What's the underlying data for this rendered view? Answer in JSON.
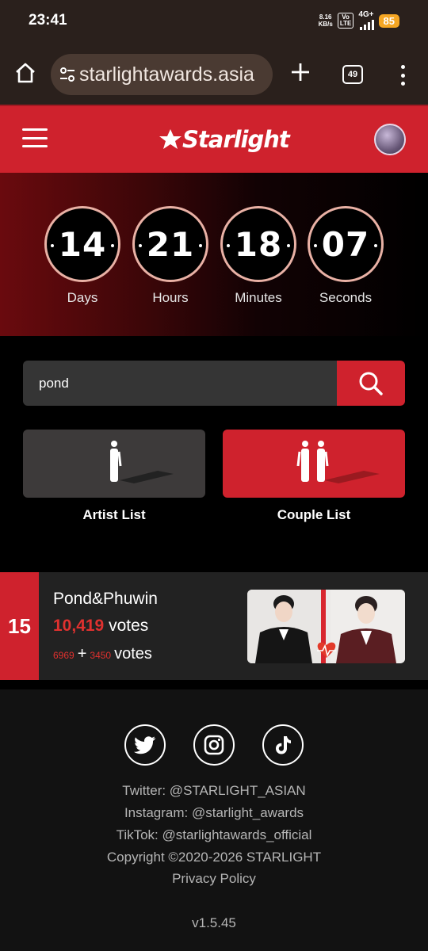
{
  "status_bar": {
    "time": "23:41",
    "net_speed_top": "8.16",
    "net_speed_bottom": "KB/s",
    "volte_top": "Vo",
    "volte_bottom": "LTE",
    "network": "4G+",
    "battery": "85"
  },
  "browser": {
    "url": "starlightawards.asia",
    "tab_count": "49"
  },
  "site_header": {
    "logo_text": "Starlight"
  },
  "countdown": [
    {
      "value": "14",
      "label": "Days"
    },
    {
      "value": "21",
      "label": "Hours"
    },
    {
      "value": "18",
      "label": "Minutes"
    },
    {
      "value": "07",
      "label": "Seconds"
    }
  ],
  "search": {
    "value": "pond"
  },
  "lists": {
    "artist_label": "Artist List",
    "couple_label": "Couple List"
  },
  "result": {
    "rank": "15",
    "name": "Pond&Phuwin",
    "total_votes": "10,419",
    "votes_word": "votes",
    "part_a": "6969",
    "plus": "+",
    "part_b": "3450",
    "votes_word2": "votes"
  },
  "footer": {
    "twitter": "Twitter: @STARLIGHT_ASIAN",
    "instagram": "Instagram: @starlight_awards",
    "tiktok": "TikTok: @starlightawards_official",
    "copyright": "Copyright ©2020-2026 STARLIGHT",
    "privacy": "Privacy Policy",
    "version": "v1.5.45"
  },
  "colors": {
    "brand_red": "#cf222d",
    "vote_red": "#e0312f",
    "ring": "#e9b1a5"
  }
}
